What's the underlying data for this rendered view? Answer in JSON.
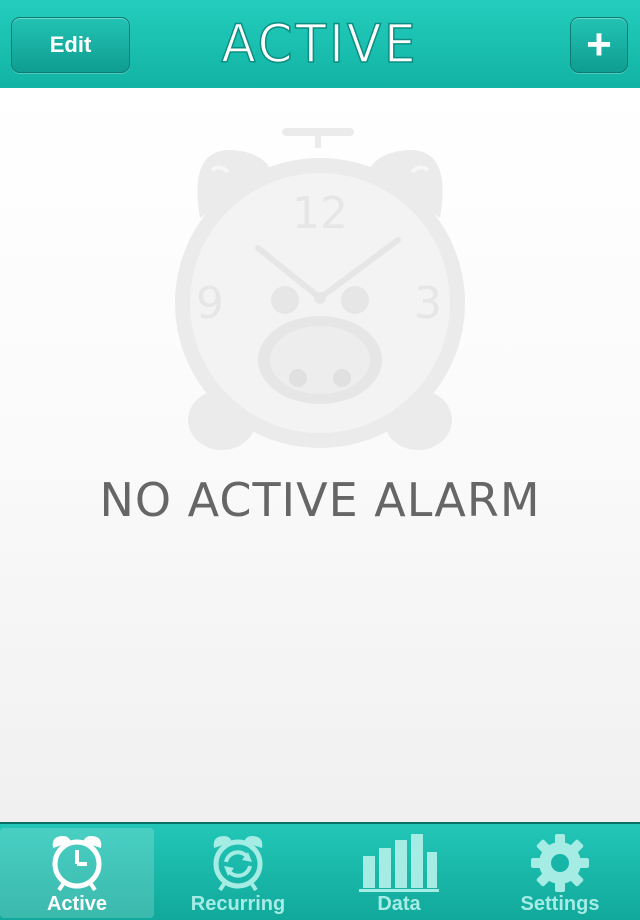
{
  "header": {
    "title": "ACTIVE",
    "edit_label": "Edit",
    "add_label": "+"
  },
  "main": {
    "empty_message": "NO ACTIVE ALARM",
    "illustration": "pig-alarm-clock-illustration"
  },
  "tabs": [
    {
      "label": "Active",
      "icon": "alarm-clock-icon",
      "selected": true
    },
    {
      "label": "Recurring",
      "icon": "recurring-alarm-icon",
      "selected": false
    },
    {
      "label": "Data",
      "icon": "bar-chart-icon",
      "selected": false
    },
    {
      "label": "Settings",
      "icon": "gear-icon",
      "selected": false
    }
  ],
  "colors": {
    "accent": "#16bcad",
    "tab_inactive": "#a5ece5",
    "empty_text": "#666666"
  }
}
